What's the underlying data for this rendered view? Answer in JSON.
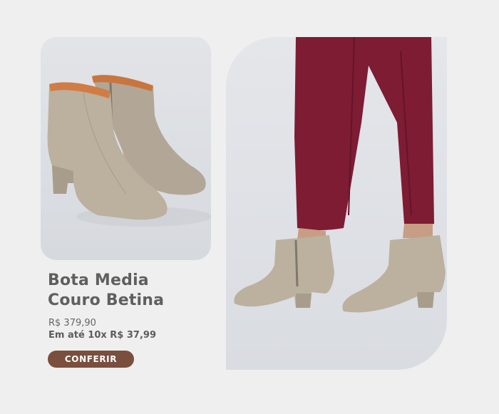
{
  "product": {
    "title_line1": "Bota Media",
    "title_line2": "Couro Betina",
    "price": "R$ 379,90",
    "installments": "Em até 10x R$ 37,99",
    "cta_label": "CONFERIR"
  },
  "images": {
    "left": "product-photo-boots-pair",
    "right": "model-photo-boots-worn"
  },
  "colors": {
    "background": "#efefef",
    "button": "#7a4f3e",
    "boot_leather": "#b9ad9c",
    "pants": "#7e1d33"
  }
}
